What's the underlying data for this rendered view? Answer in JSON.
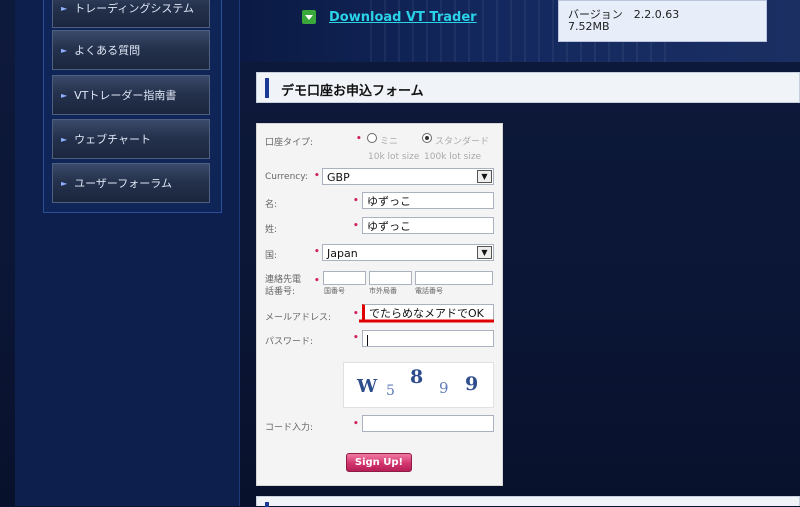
{
  "sidebar": {
    "items": [
      {
        "label": "トレーディングシステム"
      },
      {
        "label": "よくある質問"
      },
      {
        "label": "VTトレーダー指南書"
      },
      {
        "label": "ウェブチャート"
      },
      {
        "label": "ユーザーフォーラム"
      }
    ]
  },
  "download": {
    "link_text": "Download VT Trader",
    "version_line": "バージョン　2.2.0.63",
    "size": "7.52MB"
  },
  "form_header": {
    "title": "デモ口座お申込フォーム"
  },
  "form": {
    "account_type_label": "口座タイプ:",
    "account_options": [
      {
        "label": "ミニ",
        "note": "10k lot size",
        "selected": false
      },
      {
        "label": "スタンダード",
        "note": "100k lot size",
        "selected": true
      }
    ],
    "currency_label": "Currency:",
    "currency_value": "GBP",
    "first_name_label": "名:",
    "first_name_value": "ゆずっこ",
    "last_name_label": "姓:",
    "last_name_value": "ゆずっこ",
    "country_label": "国:",
    "country_value": "Japan",
    "phone_label_1": "連絡先電",
    "phone_label_2": "話番号:",
    "phone_sub": [
      "国番号",
      "市外局番",
      "電話番号"
    ],
    "email_label": "メールアドレス:",
    "email_value": "でたらめなメアドでOK",
    "password_label": "パスワード:",
    "captcha_chars": [
      "W",
      "5",
      "8",
      "9",
      "9"
    ],
    "code_label": "コード入力:",
    "signup_label": "Sign Up!"
  },
  "colors": {
    "accent_link": "#2ad3e8",
    "required_mark": "#d0215e",
    "annotation_underline": "#e00000"
  }
}
